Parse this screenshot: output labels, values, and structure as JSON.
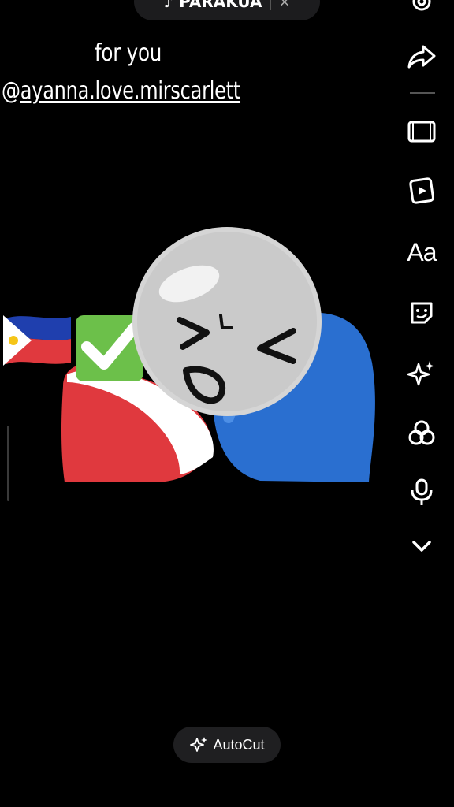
{
  "top_bar": {
    "sound_label": "♪ PARAKUA",
    "close_glyph": "×"
  },
  "caption": {
    "line1": "for you",
    "prefix": "@",
    "handle": "ayanna.love.mirscarlett"
  },
  "toolbar": {
    "items": [
      "settings-icon",
      "share-icon",
      "aspect-ratio-icon",
      "templates-icon",
      "text-tool",
      "sticker-icon",
      "effects-icon",
      "filters-icon",
      "voice-effects-icon",
      "more-icon"
    ],
    "text_tool_label": "Aa"
  },
  "sticker": {
    "description_icons": [
      "philippines-flag",
      "check-mark",
      "laughing-face",
      "red-heart",
      "blue-heart"
    ]
  },
  "bottom": {
    "autocut_label": "AutoCut"
  },
  "colors": {
    "background": "#000000",
    "pill": "#1c1c1e",
    "flag_red": "#e0393e",
    "flag_blue": "#2a6fd0",
    "check_green": "#6cc04a"
  }
}
